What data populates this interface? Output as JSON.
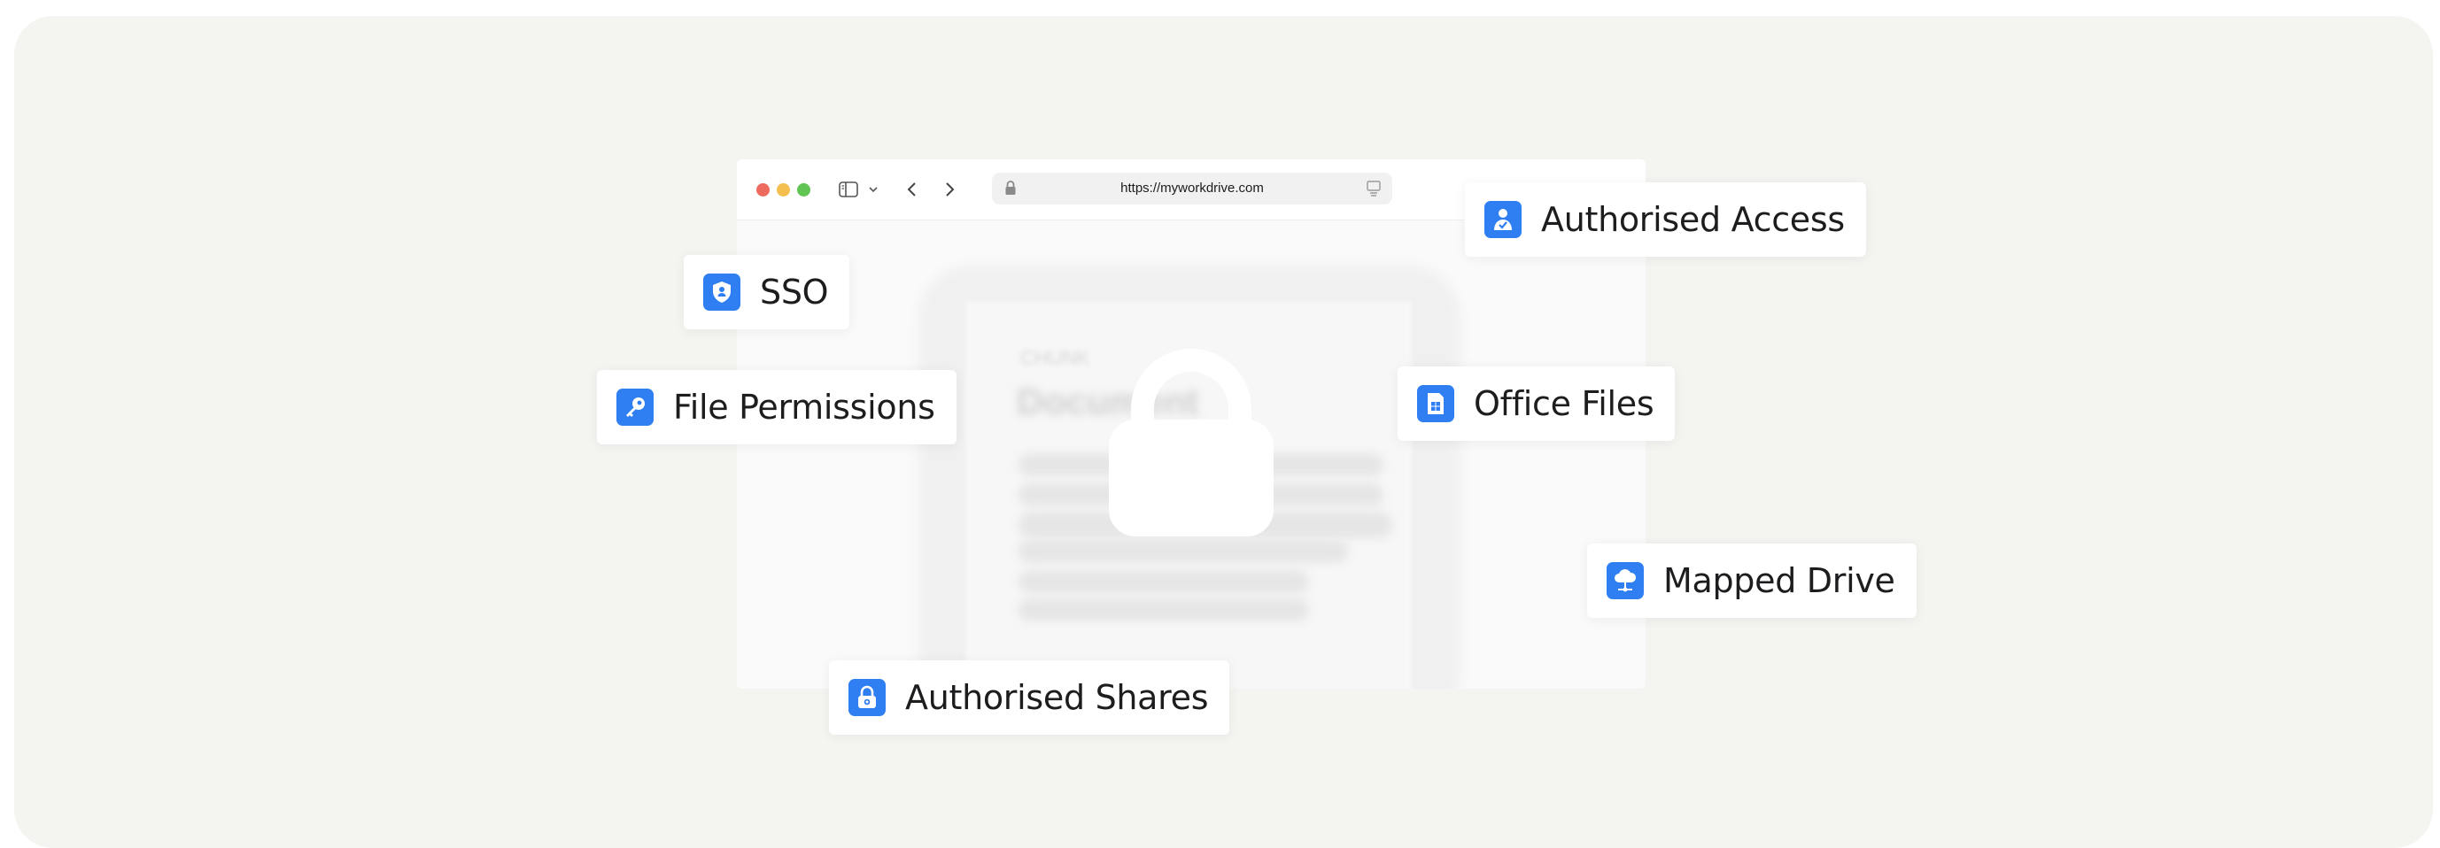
{
  "browser": {
    "url": "https://myworkdrive.com",
    "traffic_lights": {
      "close": "#ec6a5e",
      "minimize": "#f4bf4f",
      "zoom": "#61c554"
    }
  },
  "document_preview": {
    "small_label": "CHUNK",
    "title": "Document"
  },
  "accent_color": "#2f7ff3",
  "features": {
    "sso": {
      "label": "SSO",
      "icon": "shield-icon"
    },
    "file_permissions": {
      "label": "File Permissions",
      "icon": "key-icon"
    },
    "authorised_access": {
      "label": "Authorised Access",
      "icon": "user-check-icon"
    },
    "office_files": {
      "label": "Office Files",
      "icon": "office-file-icon"
    },
    "mapped_drive": {
      "label": "Mapped Drive",
      "icon": "cloud-network-icon"
    },
    "authorised_shares": {
      "label": "Authorised Shares",
      "icon": "lock-icon"
    }
  }
}
